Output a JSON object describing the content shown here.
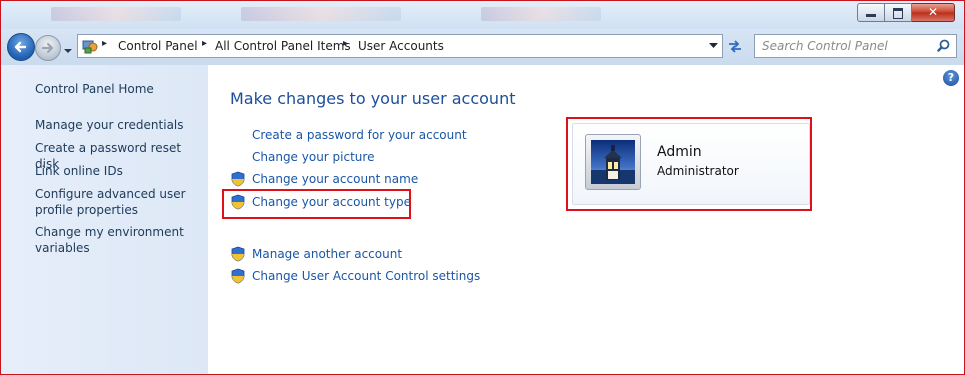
{
  "window": {
    "buttons": {
      "minimize": "minimize",
      "maximize": "maximize",
      "close": "close"
    },
    "close_glyph": "✕"
  },
  "address": {
    "breadcrumbs": [
      "Control Panel",
      "All Control Panel Items",
      "User Accounts"
    ],
    "arrow": "▸",
    "search_placeholder": "Search Control Panel"
  },
  "sidebar": {
    "home": "Control Panel Home",
    "links": [
      [
        "Manage your credentials"
      ],
      [
        "Create a password reset disk"
      ],
      [
        "Link online IDs"
      ],
      [
        "Configure advanced user",
        "profile properties"
      ],
      [
        "Change my environment",
        "variables"
      ]
    ]
  },
  "main": {
    "title": "Make changes to your user account",
    "help_glyph": "?",
    "tasks": [
      {
        "label": "Create a password for your account",
        "shield": false
      },
      {
        "label": "Change your picture",
        "shield": false
      },
      {
        "label": "Change your account name",
        "shield": true
      },
      {
        "label": "Change your account type",
        "shield": true,
        "highlighted": true
      }
    ],
    "other_tasks": [
      {
        "label": "Manage another account",
        "shield": true
      },
      {
        "label": "Change User Account Control settings",
        "shield": true
      }
    ],
    "user": {
      "name": "Admin",
      "role": "Administrator",
      "avatar": "lighthouse-picture"
    }
  },
  "colors": {
    "highlight": "#e0101b",
    "link": "#1a56a6",
    "title": "#1e4e9b"
  }
}
